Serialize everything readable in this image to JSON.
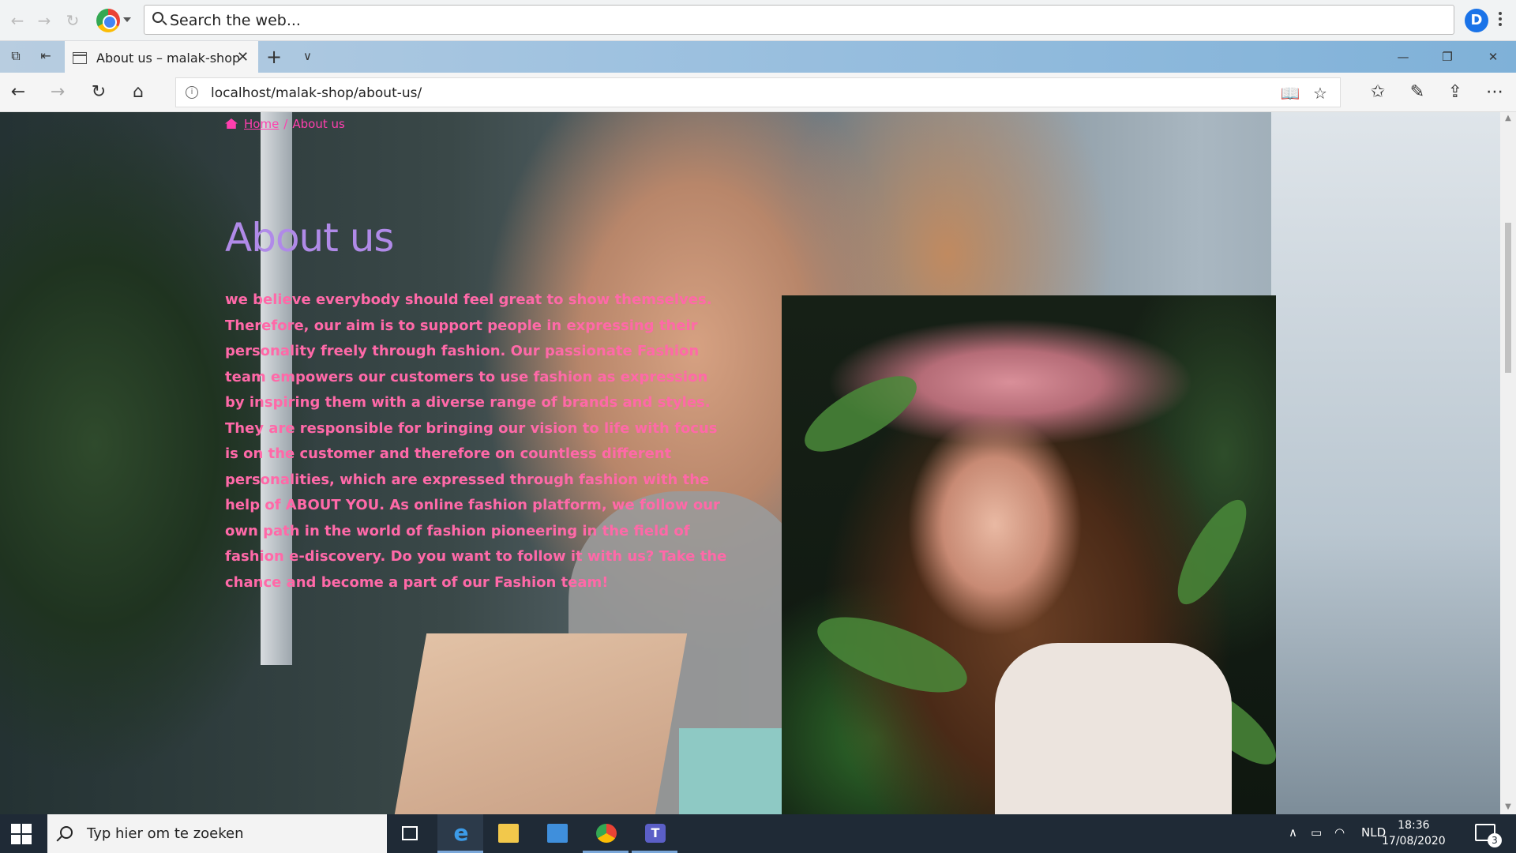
{
  "chrome": {
    "search_placeholder": "Search the web...",
    "profile_initial": "D"
  },
  "edge": {
    "tab_title": "About us – malak-shop",
    "tab_close": "✕",
    "new_tab": "+",
    "url": "localhost/malak-shop/about-us/"
  },
  "page": {
    "breadcrumb": {
      "home": "Home",
      "separator": "/",
      "current": "About us"
    },
    "title": "About us",
    "body": "we believe everybody should feel great to show themselves. Therefore, our aim is to support people in expressing their personality freely through fashion. Our passionate Fashion team empowers our customers to use fashion as expression by inspiring them with a diverse range of brands and styles. They are responsible for bringing our vision to life with focus is on the customer and therefore on countless different personalities, which are expressed through fashion with the help of ABOUT YOU. As online fashion platform, we follow our own path in the world of fashion pioneering in the field of fashion e-discovery. Do you want to follow it with us? Take the chance and become a part of our Fashion team!",
    "colors": {
      "accent_pink": "#ff3fae",
      "title_purple": "#b08ae8",
      "body_pink": "#ff69a8"
    }
  },
  "taskbar": {
    "search_placeholder": "Typ hier om te zoeken",
    "language": "NLD",
    "time": "18:36",
    "date": "17/08/2020",
    "notification_count": "3"
  }
}
